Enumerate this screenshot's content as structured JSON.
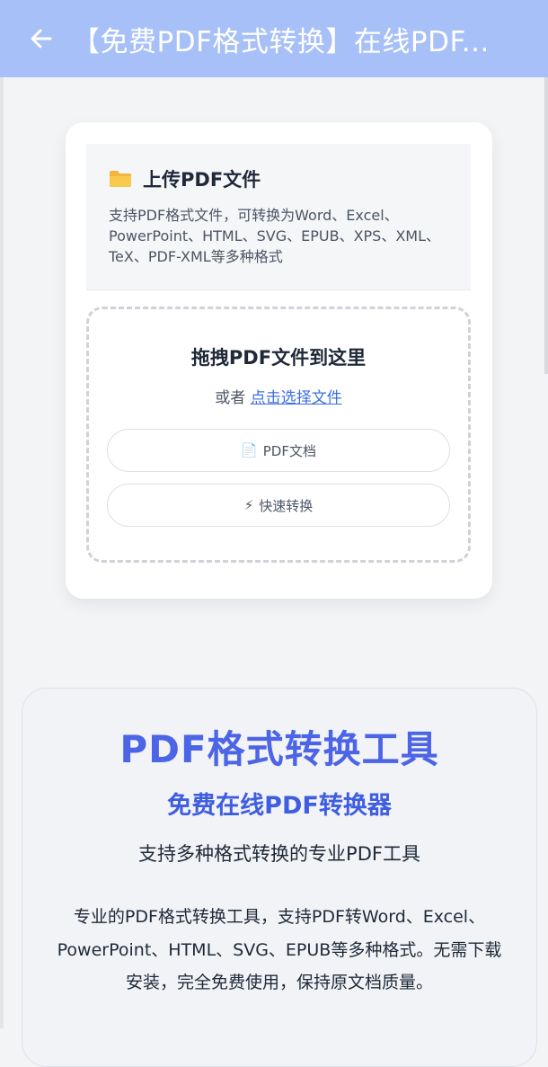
{
  "header": {
    "title": "【免费PDF格式转换】在线PDF...",
    "back_icon": "arrow-left-icon"
  },
  "upload": {
    "icon": "folder-icon",
    "title": "上传PDF文件",
    "description": "支持PDF格式文件，可转换为Word、Excel、PowerPoint、HTML、SVG、EPUB、XPS、XML、TeX、PDF-XML等多种格式",
    "drop_title": "拖拽PDF文件到这里",
    "drop_or": "或者",
    "drop_link": "点击选择文件",
    "pills": [
      {
        "icon": "📄",
        "label": "PDF文档"
      },
      {
        "icon": "⚡",
        "label": "快速转换"
      }
    ]
  },
  "info": {
    "title": "PDF格式转换工具",
    "subtitle": "免费在线PDF转换器",
    "tagline": "支持多种格式转换的专业PDF工具",
    "body": "专业的PDF格式转换工具，支持PDF转Word、Excel、PowerPoint、HTML、SVG、EPUB等多种格式。无需下载安装，完全免费使用，保持原文档质量。"
  },
  "colors": {
    "header_bg": "#a7c0f7",
    "accent": "#4c64e6",
    "link": "#3b6fe0"
  }
}
